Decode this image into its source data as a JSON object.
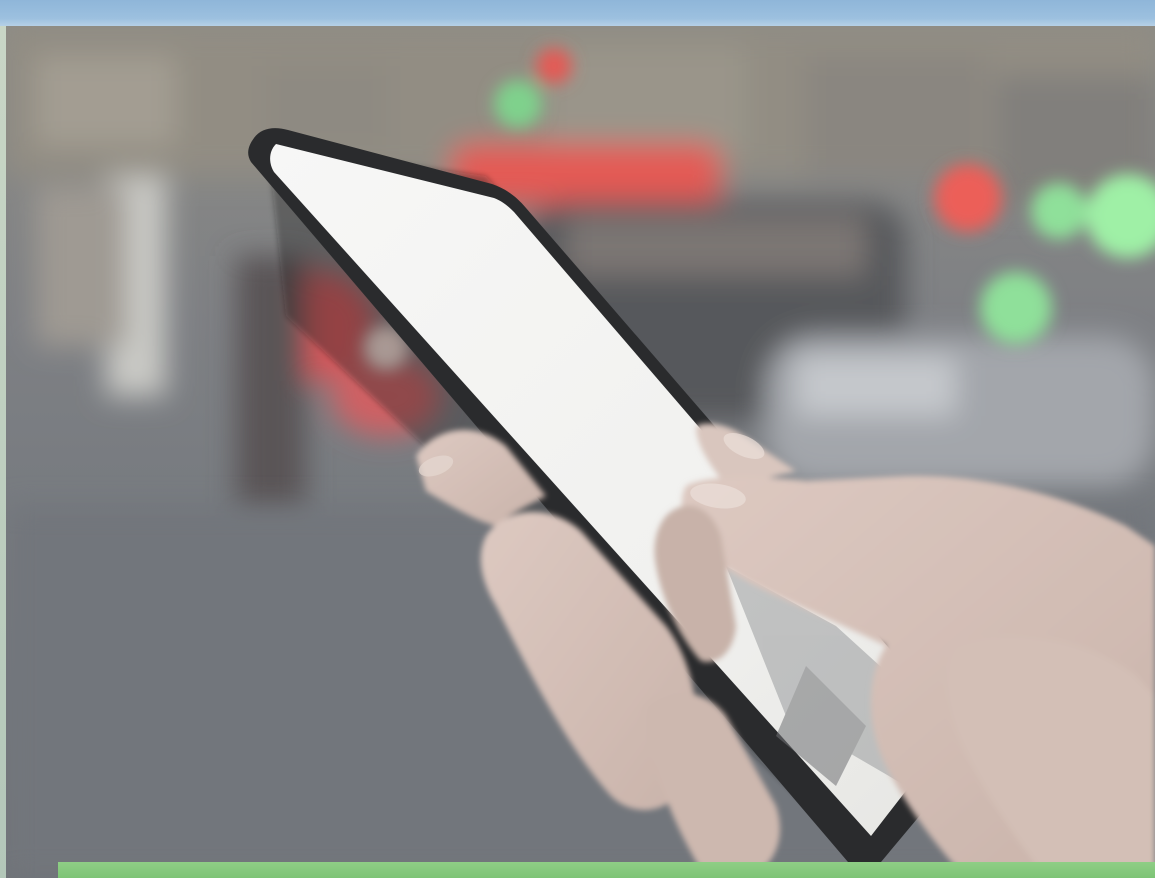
{
  "image": {
    "kind": "photograph",
    "subject": "hand-holding-smartphone",
    "palette": {
      "top_band": "#9cc0df",
      "bottom_band": "#86ca7e",
      "street": "#7d8185",
      "screen": "#f4f4f3",
      "phone_body": "#2a2b2d",
      "skin": "#d7c4bc",
      "bokeh_red": "#e45a55",
      "bokeh_green": "#8fe09a"
    }
  }
}
